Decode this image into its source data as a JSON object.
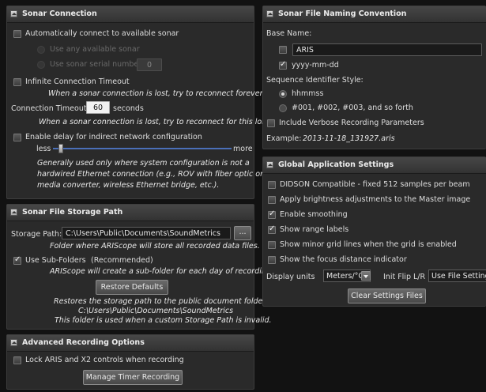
{
  "sonar_connection": {
    "title": "Sonar Connection",
    "auto_connect": "Automatically connect to available sonar",
    "use_any": "Use any available sonar",
    "use_serial": "Use sonar serial number",
    "serial_value": "0",
    "infinite_timeout": "Infinite Connection Timeout",
    "infinite_note": "When a sonar connection is lost, try to reconnect forever.",
    "timeout_label": "Connection Timeout:",
    "timeout_value": "60",
    "timeout_unit": "seconds",
    "timeout_note": "When a sonar connection is lost, try to reconnect for this long.",
    "delay_label": "Enable delay for indirect network configuration",
    "slider_less": "less",
    "slider_more": "more",
    "slider_level": 0.03,
    "delay_note_1": "Generally used only where system configuration is not a",
    "delay_note_2": "hardwired Ethernet connection (e.g., ROV with fiber optic or other",
    "delay_note_3": "media converter, wireless Ethernet bridge, etc.)."
  },
  "storage": {
    "title": "Sonar File Storage Path",
    "path_label": "Storage Path:",
    "path_value": "C:\\Users\\Public\\Documents\\SoundMetrics",
    "browse_label": "...",
    "path_note": "Folder where ARIScope will store all recorded data files.",
    "subfolders_label": "Use Sub-Folders",
    "subfolders_rec": "(Recommended)",
    "subfolders_note": "ARIScope will create a sub-folder for each day of recording.",
    "restore_label": "Restore Defaults",
    "restore_note_1": "Restores the storage path to the public document folder:",
    "restore_note_2": "C:\\Users\\Public\\Documents\\SoundMetrics",
    "restore_note_3": "This folder is used when a custom Storage Path is invalid."
  },
  "advanced": {
    "title": "Advanced Recording Options",
    "lock_label": "Lock ARIS and X2 controls when recording",
    "timer_label": "Manage Timer Recording"
  },
  "naming": {
    "title": "Sonar File Naming Convention",
    "base_name_label": "Base Name:",
    "base_value": "ARIS",
    "date_label": "yyyy-mm-dd",
    "seq_label": "Sequence Identifier Style:",
    "opt_time": "hhmmss",
    "opt_num": "#001, #002, #003, and so forth",
    "verbose_label": "Include Verbose Recording Parameters",
    "example_label": "Example:",
    "example_value": "2013-11-18_131927.aris"
  },
  "global": {
    "title": "Global Application Settings",
    "didson": "DIDSON Compatible - fixed 512 samples per beam",
    "brightness": "Apply brightness adjustments to the Master image",
    "smoothing": "Enable smoothing",
    "range_labels": "Show range labels",
    "minor_grid": "Show minor grid lines when the grid is enabled",
    "focus": "Show the focus distance indicator",
    "units_label": "Display units",
    "units_value": "Meters/°C",
    "flip_label": "Init Flip L/R",
    "flip_value": "Use File Setting",
    "clear_label": "Clear Settings Files"
  }
}
